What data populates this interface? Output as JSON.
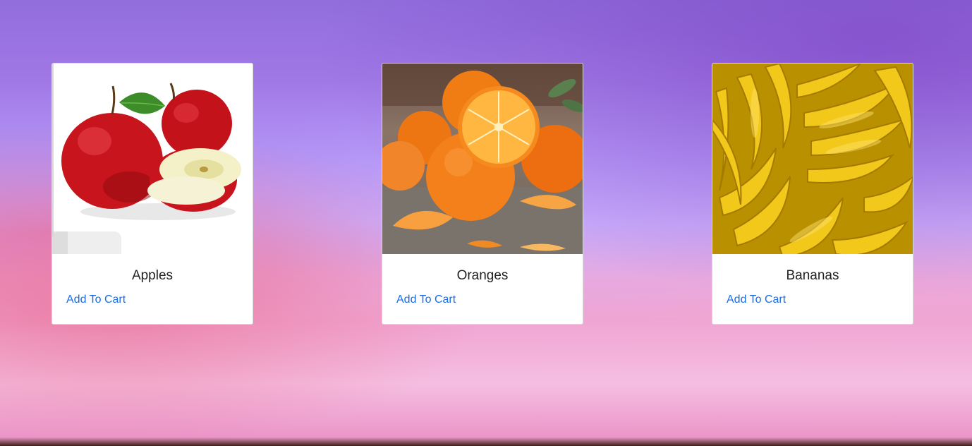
{
  "products": [
    {
      "name": "Apples",
      "action_label": "Add To Cart"
    },
    {
      "name": "Oranges",
      "action_label": "Add To Cart"
    },
    {
      "name": "Bananas",
      "action_label": "Add To Cart"
    }
  ],
  "colors": {
    "link": "#1a6ee8",
    "card_bg": "#ffffff",
    "title_text": "#222222"
  },
  "icons": [
    "apples-image",
    "oranges-image",
    "bananas-image"
  ]
}
